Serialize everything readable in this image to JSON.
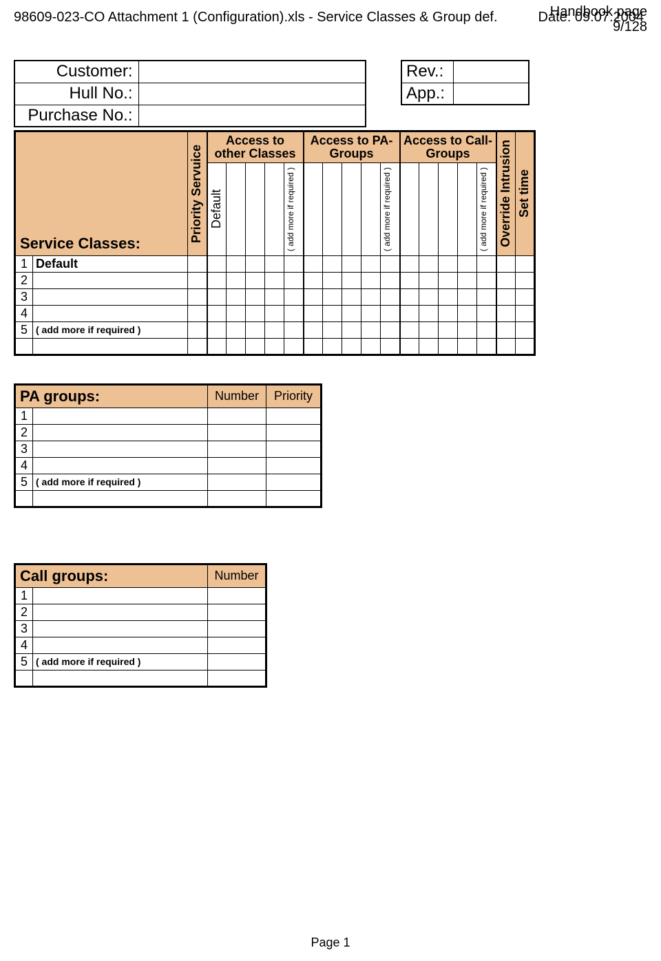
{
  "header": {
    "handbook": "Handbook page",
    "page_of": "9/128",
    "file": "98609-023-CO Attachment 1 (Configuration).xls   - Service Classes & Group def.",
    "date_label": "Date:",
    "date": "09.07.2004"
  },
  "cust": {
    "customer_l": "Customer:",
    "hull_l": "Hull No.:",
    "purchase_l": "Purchase No.:",
    "customer_v": "",
    "hull_v": "",
    "purchase_v": ""
  },
  "rev": {
    "rev_l": "Rev.:",
    "app_l": "App.:",
    "rev_v": "",
    "app_v": ""
  },
  "svc": {
    "title": "Service Classes:",
    "col_priority": "Priority Servuice",
    "grp1": "Access to other Classes",
    "grp2": "Access to PA-Groups",
    "grp3": "Access to Call-Groups",
    "col_default": "Default",
    "col_addmore": "( add more if required )",
    "col_override": "Override Intrusion",
    "col_settime": "Set time",
    "rows": [
      {
        "n": "1",
        "name": "Default"
      },
      {
        "n": "2",
        "name": ""
      },
      {
        "n": "3",
        "name": ""
      },
      {
        "n": "4",
        "name": ""
      },
      {
        "n": "5",
        "name": "( add more if required )"
      },
      {
        "n": "",
        "name": ""
      }
    ]
  },
  "pa": {
    "title": "PA groups:",
    "col_number": "Number",
    "col_priority": "Priority",
    "rows": [
      {
        "n": "1",
        "name": ""
      },
      {
        "n": "2",
        "name": ""
      },
      {
        "n": "3",
        "name": ""
      },
      {
        "n": "4",
        "name": ""
      },
      {
        "n": "5",
        "name": "( add more if required )"
      },
      {
        "n": "",
        "name": ""
      }
    ]
  },
  "call": {
    "title": "Call groups:",
    "col_number": "Number",
    "rows": [
      {
        "n": "1",
        "name": ""
      },
      {
        "n": "2",
        "name": ""
      },
      {
        "n": "3",
        "name": ""
      },
      {
        "n": "4",
        "name": ""
      },
      {
        "n": "5",
        "name": "( add more if required )"
      },
      {
        "n": "",
        "name": ""
      }
    ]
  },
  "footer": {
    "page": "Page 1"
  }
}
